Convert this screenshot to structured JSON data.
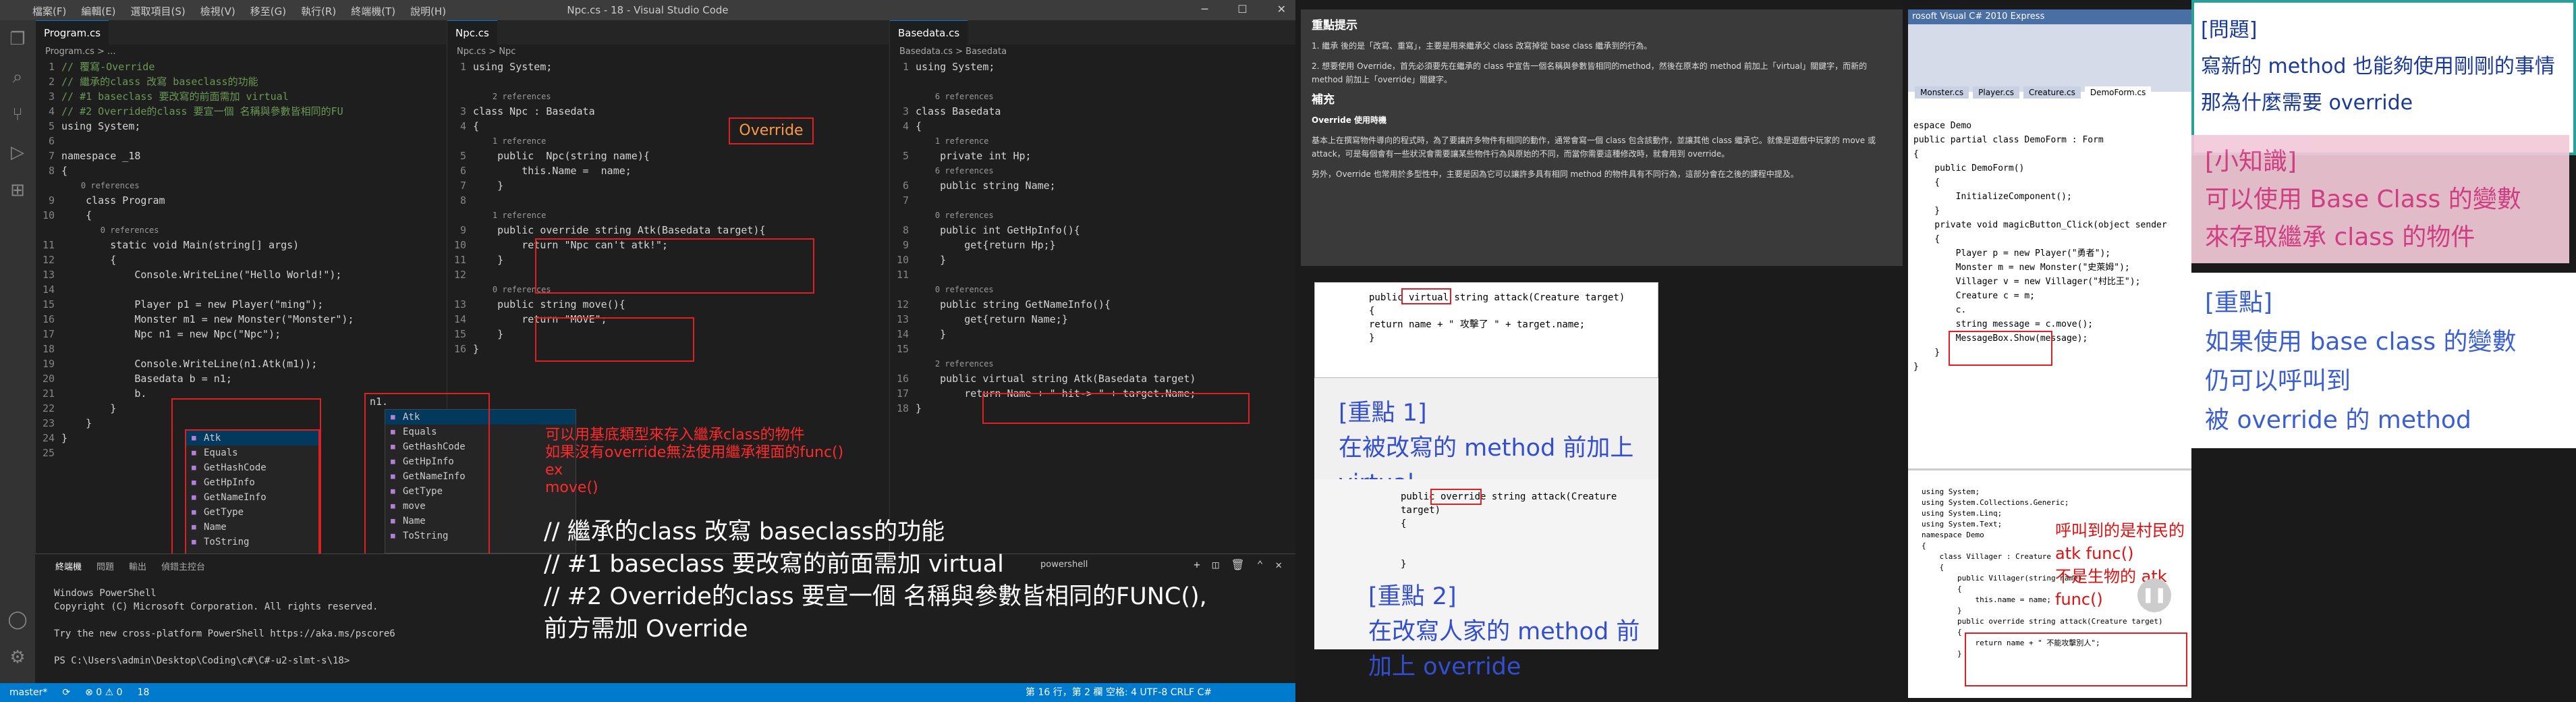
{
  "window": {
    "menus": [
      "檔案(F)",
      "編輯(E)",
      "選取項目(S)",
      "檢視(V)",
      "移至(G)",
      "執行(R)",
      "終端機(T)",
      "說明(H)"
    ],
    "title": "Npc.cs - 18 - Visual Studio Code"
  },
  "panes": {
    "program": {
      "tab": "Program.cs",
      "crumb": "Program.cs > ...",
      "lines": [
        {
          "n": "1",
          "t": "// 覆寫-Override",
          "c": "cm"
        },
        {
          "n": "2",
          "t": "// 繼承的class 改寫 baseclass的功能",
          "c": "cm"
        },
        {
          "n": "3",
          "t": "// #1 baseclass 要改寫的前面需加 virtual",
          "c": "cm"
        },
        {
          "n": "4",
          "t": "// #2 Override的class 要宣一個 名稱與參數皆相同的FU",
          "c": "cm"
        },
        {
          "n": "5",
          "t": "using System;",
          "c": "lt"
        },
        {
          "n": "6",
          "t": "",
          "c": "lt"
        },
        {
          "n": "7",
          "t": "namespace _18",
          "c": "lt"
        },
        {
          "n": "8",
          "t": "{",
          "c": "lt"
        },
        {
          "n": "",
          "t": "    0 references",
          "c": "lens"
        },
        {
          "n": "9",
          "t": "    class Program",
          "c": "lt"
        },
        {
          "n": "10",
          "t": "    {",
          "c": "lt"
        },
        {
          "n": "",
          "t": "        0 references",
          "c": "lens"
        },
        {
          "n": "11",
          "t": "        static void Main(string[] args)",
          "c": "lt"
        },
        {
          "n": "12",
          "t": "        {",
          "c": "lt"
        },
        {
          "n": "13",
          "t": "            Console.WriteLine(\"Hello World!\");",
          "c": "lt"
        },
        {
          "n": "14",
          "t": "",
          "c": "lt"
        },
        {
          "n": "15",
          "t": "            Player p1 = new Player(\"ming\");",
          "c": "lt"
        },
        {
          "n": "16",
          "t": "            Monster m1 = new Monster(\"Monster\");",
          "c": "lt"
        },
        {
          "n": "17",
          "t": "            Npc n1 = new Npc(\"Npc\");",
          "c": "lt"
        },
        {
          "n": "18",
          "t": "",
          "c": "lt"
        },
        {
          "n": "19",
          "t": "            Console.WriteLine(n1.Atk(m1));",
          "c": "lt"
        },
        {
          "n": "20",
          "t": "            Basedata b = n1;",
          "c": "lt"
        },
        {
          "n": "21",
          "t": "            b.",
          "c": "lt"
        },
        {
          "n": "22",
          "t": "        }",
          "c": "lt"
        },
        {
          "n": "23",
          "t": "    }",
          "c": "lt"
        },
        {
          "n": "24",
          "t": "}",
          "c": "lt"
        },
        {
          "n": "25",
          "t": "",
          "c": "lt"
        }
      ],
      "autocomplete": [
        "Atk",
        "Equals",
        "GetHashCode",
        "GetHpInfo",
        "GetNameInfo",
        "GetType",
        "Name",
        "ToString"
      ]
    },
    "npc": {
      "tab": "Npc.cs",
      "crumb": "Npc.cs > Npc",
      "lines": [
        {
          "n": "1",
          "t": "using System;",
          "c": "lt"
        },
        {
          "n": "",
          "t": "",
          "c": "lt"
        },
        {
          "n": "",
          "t": "    2 references",
          "c": "lens"
        },
        {
          "n": "3",
          "t": "class Npc : Basedata",
          "c": "lt"
        },
        {
          "n": "4",
          "t": "{",
          "c": "lt"
        },
        {
          "n": "",
          "t": "    1 reference",
          "c": "lens"
        },
        {
          "n": "5",
          "t": "    public  Npc(string name){",
          "c": "lt"
        },
        {
          "n": "6",
          "t": "        this.Name =  name;",
          "c": "lt"
        },
        {
          "n": "7",
          "t": "    }",
          "c": "lt"
        },
        {
          "n": "8",
          "t": "",
          "c": "lt"
        },
        {
          "n": "",
          "t": "    1 reference",
          "c": "lens"
        },
        {
          "n": "9",
          "t": "    public override string Atk(Basedata target){",
          "c": "lt"
        },
        {
          "n": "10",
          "t": "        return \"Npc can't atk!\";",
          "c": "lt"
        },
        {
          "n": "11",
          "t": "    }",
          "c": "lt"
        },
        {
          "n": "12",
          "t": "",
          "c": "lt"
        },
        {
          "n": "",
          "t": "    0 references",
          "c": "lens"
        },
        {
          "n": "13",
          "t": "    public string move(){",
          "c": "lt"
        },
        {
          "n": "14",
          "t": "        return \"MOVE\";",
          "c": "lt"
        },
        {
          "n": "15",
          "t": "    }",
          "c": "lt"
        },
        {
          "n": "16",
          "t": "}",
          "c": "lt"
        }
      ],
      "override_label": "Override",
      "autocomplete_input": "n1.",
      "autocomplete": [
        "Atk",
        "Equals",
        "GetHashCode",
        "GetHpInfo",
        "GetNameInfo",
        "GetType",
        "move",
        "Name",
        "ToString"
      ]
    },
    "basedata": {
      "tab": "Basedata.cs",
      "crumb": "Basedata.cs > Basedata",
      "lines": [
        {
          "n": "1",
          "t": "using System;",
          "c": "lt"
        },
        {
          "n": "",
          "t": "",
          "c": "lt"
        },
        {
          "n": "",
          "t": "    6 references",
          "c": "lens"
        },
        {
          "n": "3",
          "t": "class Basedata",
          "c": "lt"
        },
        {
          "n": "4",
          "t": "{",
          "c": "lt"
        },
        {
          "n": "",
          "t": "    1 reference",
          "c": "lens"
        },
        {
          "n": "5",
          "t": "    private int Hp;",
          "c": "lt"
        },
        {
          "n": "",
          "t": "    6 references",
          "c": "lens"
        },
        {
          "n": "6",
          "t": "    public string Name;",
          "c": "lt"
        },
        {
          "n": "7",
          "t": "",
          "c": "lt"
        },
        {
          "n": "",
          "t": "    0 references",
          "c": "lens"
        },
        {
          "n": "8",
          "t": "    public int GetHpInfo(){",
          "c": "lt"
        },
        {
          "n": "9",
          "t": "        get{return Hp;}",
          "c": "lt"
        },
        {
          "n": "10",
          "t": "    }",
          "c": "lt"
        },
        {
          "n": "11",
          "t": "",
          "c": "lt"
        },
        {
          "n": "",
          "t": "    0 references",
          "c": "lens"
        },
        {
          "n": "12",
          "t": "    public string GetNameInfo(){",
          "c": "lt"
        },
        {
          "n": "13",
          "t": "        get{return Name;}",
          "c": "lt"
        },
        {
          "n": "14",
          "t": "    }",
          "c": "lt"
        },
        {
          "n": "15",
          "t": "",
          "c": "lt"
        },
        {
          "n": "",
          "t": "    2 references",
          "c": "lens"
        },
        {
          "n": "16",
          "t": "    public virtual string Atk(Basedata target)",
          "c": "lt"
        },
        {
          "n": "17",
          "t": "        return Name + \" hit-> \" + target.Name;",
          "c": "lt"
        },
        {
          "n": "18",
          "t": "}",
          "c": "lt"
        }
      ]
    }
  },
  "notes": {
    "red": [
      "可以用基底類型來存入繼承class的物件",
      "如果沒有override無法使用繼承裡面的func()",
      "ex",
      "move()"
    ],
    "big": [
      "// 繼承的class 改寫 baseclass的功能",
      "// #1 baseclass 要改寫的前面需加 virtual",
      "// #2 Override的class 要宣一個 名稱與參數皆相同的FUNC(),",
      "前方需加 Override"
    ]
  },
  "panel": {
    "tabs": [
      "終端機",
      "問題",
      "輸出",
      "偵錯主控台"
    ],
    "shell": "powershell",
    "terminal": "Windows PowerShell\nCopyright (C) Microsoft Corporation. All rights reserved.\n\nTry the new cross-platform PowerShell https://aka.ms/pscore6\n\nPS C:\\Users\\admin\\Desktop\\Coding\\c#\\C#-u2-slmt-s\\18>"
  },
  "status": {
    "left": [
      "master*",
      "⟳",
      "⊗ 0 ⚠ 0",
      "18"
    ],
    "right": "第 16 行，第 2 欄   空格: 4   UTF-8   CRLF   C#"
  },
  "doc": {
    "title": "重點提示",
    "p1": "1. 繼承 後的是「改寫、重寫」，主要是用來繼承父 class 改寫掉從 base class 繼承到的行為。",
    "p2": "2. 想要使用 Override，首先必須要先在繼承的 class 中宣告一個名稱與參數皆相同的method，然後在原本的 method 前加上「virtual」關鍵字，而新的 method 前加上「override」關鍵字。",
    "h2": "補充",
    "h3": "Override 使用時機",
    "p3": "基本上在撰寫物件導向的程式時，為了要讓許多物件有相同的動作，通常會寫一個 class 包含該動作，並讓其他 class 繼承它。就像是遊戲中玩家的 move 或 attack，可是每個會有一些狀況會需要讓某些物件行為與原始的不同，而當你需要這種修改時，就會用到 override。",
    "p4": "另外，Override 也常用於多型性中，主要是因為它可以讓許多具有相同 method 的物件具有不同行為，這部分會在之後的課程中提及。"
  },
  "key1": {
    "code1": "public virtual string attack(Creature target)",
    "code2": "{",
    "code3": "    return name + \" 攻擊了 \" + target.name;",
    "code4": "}",
    "label": "[重點 1]",
    "text": "在被改寫的 method 前加上 virtual"
  },
  "key2": {
    "code1": "public override string attack(Creature target)",
    "code2": "{",
    "code3": "}",
    "label": "[重點 2]",
    "text": "在改寫人家的 method 前加上 override"
  },
  "vs2010": {
    "title": "rosoft Visual C# 2010 Express",
    "tabs": [
      "Monster.cs",
      "Player.cs",
      "Creature.cs",
      "DemoForm.cs"
    ],
    "code": [
      "espace Demo",
      "",
      "public partial class DemoForm : Form",
      "{",
      "    public DemoForm()",
      "    {",
      "        InitializeComponent();",
      "    }",
      "",
      "    private void magicButton_Click(object sender",
      "    {",
      "        Player p = new Player(\"勇者\");",
      "        Monster m = new Monster(\"史萊姆\");",
      "        Villager v = new Villager(\"村比王\");",
      "",
      "        Creature c = m;",
      "        c.",
      "        string message = c.move();",
      "",
      "        MessageBox.Show(message);",
      "    }",
      "}"
    ],
    "code2": [
      "using System;",
      "using System.Collections.Generic;",
      "using System.Linq;",
      "using System.Text;",
      "",
      "namespace Demo",
      "{",
      "    class Villager : Creature",
      "    {",
      "        public Villager(string name)",
      "        {",
      "            this.name = name;",
      "        }",
      "",
      "        public override string attack(Creature target)",
      "        {",
      "            return name + \" 不能攻擊別人\";",
      "        }"
    ],
    "note1": "呼叫到的是村民的atk func()",
    "note2": "不是生物的 atk func()"
  },
  "zh": {
    "q_label": "[問題]",
    "q1": "寫新的 method 也能夠使用剛剛的事情",
    "q2": "那為什麼需要 override",
    "k_label": "[小知識]",
    "k1": "可以使用 Base Class 的變數",
    "k2": "來存取繼承 class 的物件",
    "p_label": "[重點]",
    "p1": "如果使用 base class 的變數",
    "p2": "仍可以呼叫到",
    "p3": "被 override 的 method"
  }
}
